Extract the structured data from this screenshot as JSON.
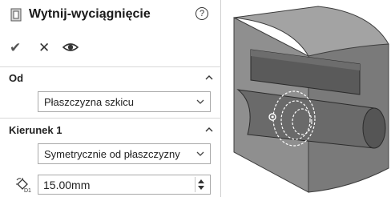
{
  "header": {
    "title": "Wytnij-wyciągnięcie",
    "help_glyph": "?"
  },
  "actions": {
    "ok_glyph": "✔",
    "cancel_glyph": "✕"
  },
  "from_group": {
    "label": "Od",
    "selected": "Płaszczyzna szkicu"
  },
  "direction_group": {
    "label": "Kierunek 1",
    "selected": "Symetrycznie od płaszczyzny",
    "depth_value": "15.00mm"
  },
  "icons": [
    "cut-extrude-icon",
    "help-icon",
    "confirm-icon",
    "cancel-icon",
    "eye-icon",
    "collapse-icon",
    "dropdown-arrow-icon",
    "depth-icon",
    "spin-up-icon",
    "spin-down-icon"
  ],
  "colors": {
    "title": "#1a1a1a",
    "model_fill": "#8f8f8f",
    "model_shadow": "#595959",
    "highlight": "#ffffff"
  }
}
